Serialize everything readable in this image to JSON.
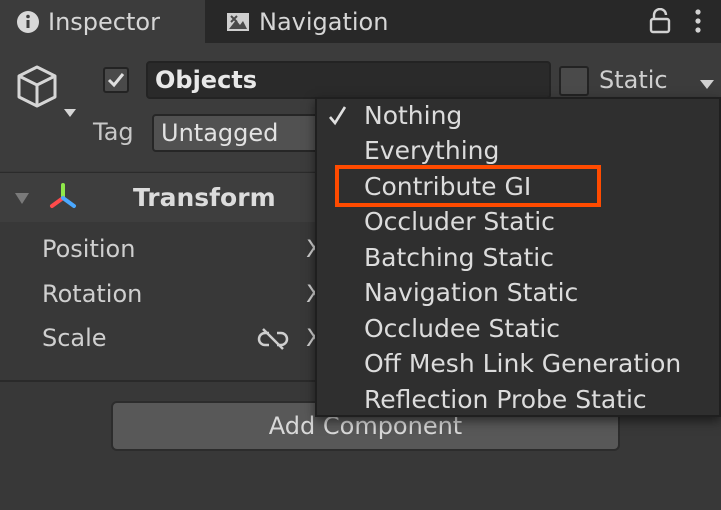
{
  "tabs": {
    "inspector": "Inspector",
    "navigation": "Navigation"
  },
  "object": {
    "name": "Objects",
    "active_checked": true,
    "static_label": "Static",
    "static_checked": false,
    "tag_label": "Tag",
    "tag_value": "Untagged"
  },
  "transform": {
    "title": "Transform",
    "fields": [
      "Position",
      "Rotation",
      "Scale"
    ],
    "axis_label": "X"
  },
  "add_component_label": "Add Component",
  "static_menu": {
    "items": [
      {
        "label": "Nothing",
        "checked": true
      },
      {
        "label": "Everything",
        "checked": false
      },
      {
        "label": "Contribute GI",
        "checked": false,
        "highlighted": true
      },
      {
        "label": "Occluder Static",
        "checked": false
      },
      {
        "label": "Batching Static",
        "checked": false
      },
      {
        "label": "Navigation Static",
        "checked": false
      },
      {
        "label": "Occludee Static",
        "checked": false
      },
      {
        "label": "Off Mesh Link Generation",
        "checked": false
      },
      {
        "label": "Reflection Probe Static",
        "checked": false
      }
    ]
  },
  "colors": {
    "highlight": "#ff4b00",
    "transform_icon_red": "#ff4b4b",
    "transform_icon_green": "#8fe84a",
    "transform_icon_blue": "#4aa8ff"
  }
}
